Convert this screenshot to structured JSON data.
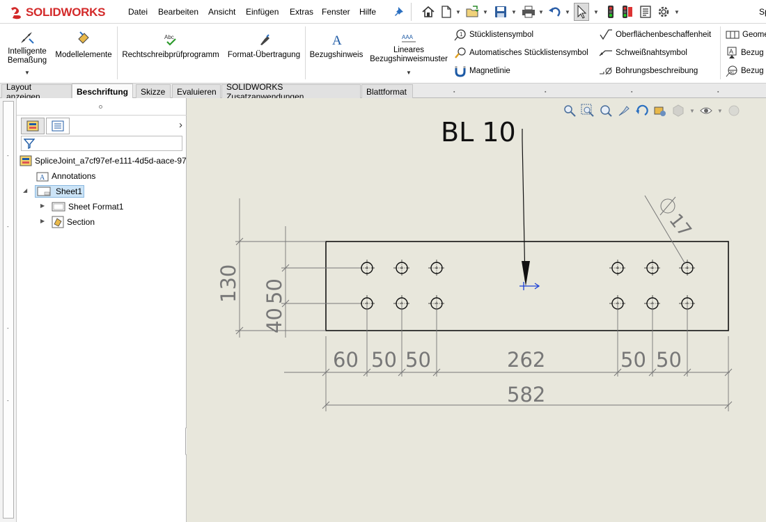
{
  "app": {
    "logo_text": "SOLIDWORKS",
    "colors": {
      "brand": "#d32a2a",
      "selection": "#cce4f7",
      "canvas": "#e8e7dc"
    }
  },
  "menu": {
    "items": [
      "Datei",
      "Bearbeiten",
      "Ansicht",
      "Einfügen",
      "Extras",
      "Fenster",
      "Hilfe"
    ],
    "truncated_right": "Sp"
  },
  "toolbar_icons": [
    "pin-icon",
    "home-icon",
    "new-document-icon",
    "open-icon",
    "save-icon",
    "print-icon",
    "undo-icon",
    "select-icon",
    "traffic-light-icon",
    "rebuild-icon",
    "file-properties-icon",
    "options-gear-icon"
  ],
  "ribbon": {
    "smart_dimension": "Intelligente\nBemaßung",
    "model_items": "Modellelemente",
    "spell_checker": "Rechtschreibprüfprogramm",
    "format_painter": "Format-Übertragung",
    "note": "Bezugshinweis",
    "linear_note_pattern": "Lineares\nBezugshinweismuster",
    "balloon": "Stücklistensymbol",
    "auto_balloon": "Automatisches Stücklistensymbol",
    "magnetic_line": "Magnetlinie",
    "surface_finish": "Oberflächenbeschaffenheit",
    "weld_symbol": "Schweißnahtsymbol",
    "hole_callout": "Bohrungsbeschreibung",
    "geom_tolerance": "Geome",
    "datum_feature": "Bezug",
    "datum_target": "Bezug"
  },
  "tabs": [
    "Layout anzeigen",
    "Beschriftung",
    "Skizze",
    "Evaluieren",
    "SOLIDWORKS Zusatzanwendungen",
    "Blattformat"
  ],
  "active_tab": "Beschriftung",
  "tree": {
    "root": "SpliceJoint_a7cf97ef-e111-4d5d-aace-97c",
    "annotations": "Annotations",
    "sheet": "Sheet1",
    "sheet_format": "Sheet Format1",
    "section": "Section"
  },
  "drawing": {
    "note_text": "BL 10",
    "dims": {
      "overall_height": "130",
      "row_spacing": "50",
      "row_offset": "40",
      "hole_diameter": "17",
      "x_first": "60",
      "x_pitch_1": "50",
      "x_pitch_2": "50",
      "x_gap": "262",
      "x_pitch_3": "50",
      "x_pitch_4": "50",
      "overall_length": "582"
    }
  }
}
